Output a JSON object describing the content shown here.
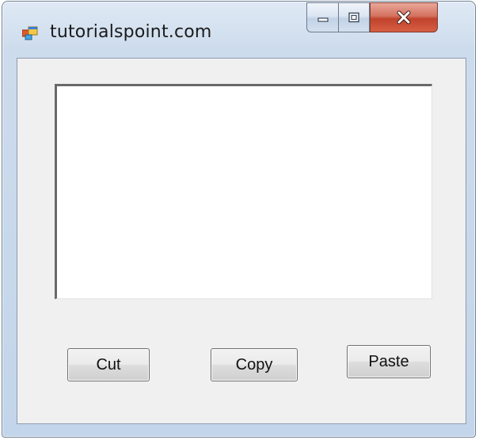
{
  "window": {
    "title": "tutorialspoint.com"
  },
  "caption_buttons": {
    "minimize_icon": "minimize-icon",
    "maximize_icon": "maximize-icon",
    "close_icon": "close-icon"
  },
  "textbox": {
    "value": ""
  },
  "buttons": {
    "cut": "Cut",
    "copy": "Copy",
    "paste": "Paste"
  },
  "colors": {
    "title_bar": "#cddcec",
    "close_button": "#c1432c",
    "form_background": "#f0f0f0",
    "textbox_background": "#ffffff"
  }
}
